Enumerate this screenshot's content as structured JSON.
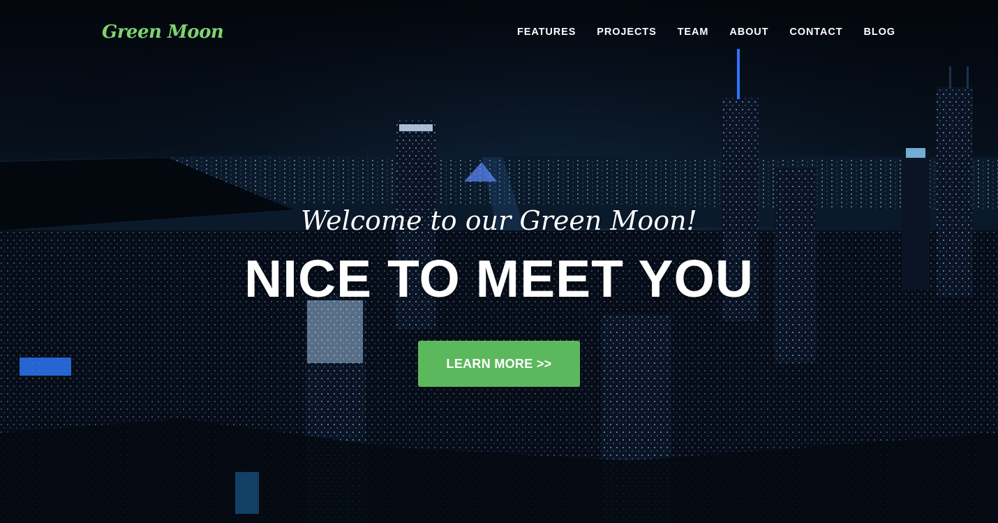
{
  "brand": {
    "name": "Green Moon",
    "color": "#7ed36f"
  },
  "nav": {
    "items": [
      {
        "label": "FEATURES"
      },
      {
        "label": "PROJECTS"
      },
      {
        "label": "TEAM"
      },
      {
        "label": "ABOUT"
      },
      {
        "label": "CONTACT"
      },
      {
        "label": "BLOG"
      }
    ]
  },
  "hero": {
    "lead_in": "Welcome to our Green Moon!",
    "heading": "NICE TO MEET YOU",
    "cta_label": "LEARN MORE >>",
    "cta_color": "#5cb85c",
    "background": "night-city-skyline-image"
  }
}
